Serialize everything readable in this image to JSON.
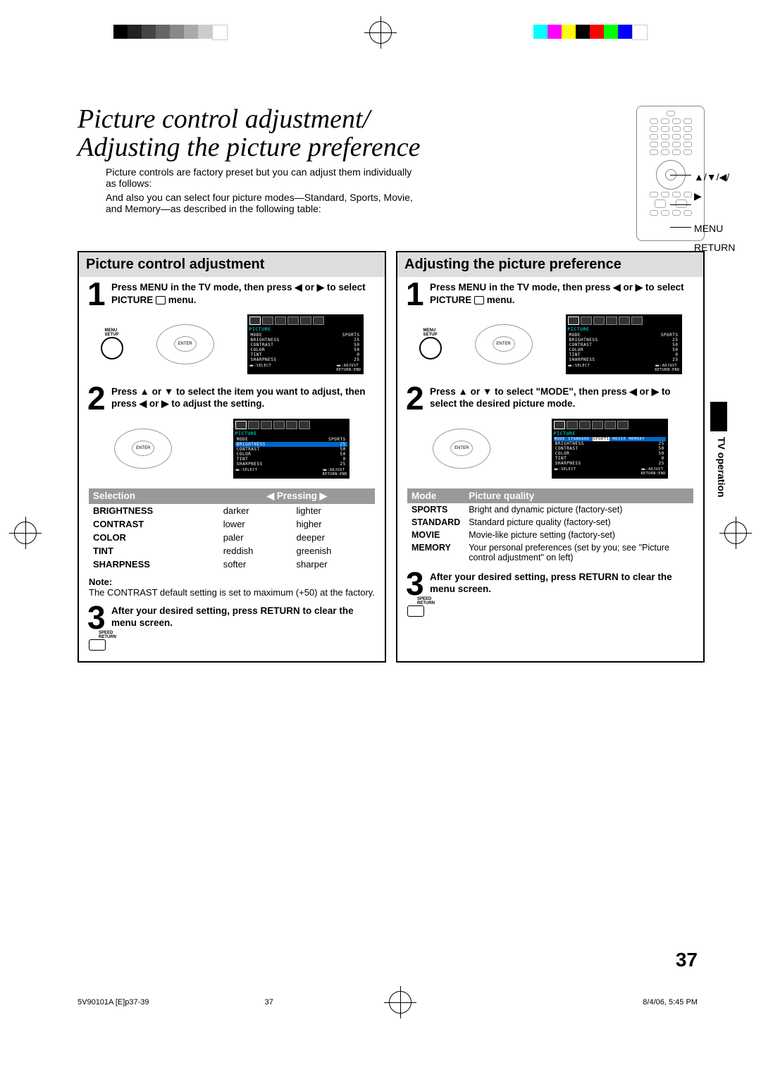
{
  "print_marks": {
    "gray_steps": [
      "#000",
      "#222",
      "#444",
      "#666",
      "#888",
      "#aaa",
      "#ccc",
      "#fff"
    ],
    "color_steps": [
      "#0ff",
      "#f0f",
      "#ff0",
      "#000",
      "#f00",
      "#0f0",
      "#00f",
      "#fff"
    ]
  },
  "title": {
    "line1": "Picture control adjustment/",
    "line2": "Adjusting the picture preference"
  },
  "intro": {
    "p1": "Picture controls are factory preset but you can adjust them individually as follows:",
    "p2": "And also you can select four picture modes—Standard, Sports, Movie, and Memory—as described in the following table:"
  },
  "remote": {
    "arrows_label": "▲/▼/◀/▶",
    "menu_label": "MENU",
    "return_label": "RETURN"
  },
  "side_tab": "TV operation",
  "page_number": "37",
  "footer": {
    "left": "5V90101A [E]p37-39",
    "center": "37",
    "right": "8/4/06, 5:45 PM"
  },
  "left_col": {
    "heading": "Picture control adjustment",
    "step1": "Press MENU in the TV mode, then press ◀ or ▶ to select PICTURE",
    "step1_suffix": " menu.",
    "menu_btn": "MENU\nSETUP",
    "enter_label": "ENTER",
    "step2": "Press ▲ or ▼ to select the item you want to adjust, then press ◀ or ▶ to adjust the setting.",
    "osd": {
      "title": "PICTURE",
      "rows": [
        [
          "MODE",
          "SPORTS"
        ],
        [
          "BRIGHTNESS",
          "25"
        ],
        [
          "CONTRAST",
          "50"
        ],
        [
          "COLOR",
          "50"
        ],
        [
          "TINT",
          "0"
        ],
        [
          "SHARPNESS",
          "25"
        ]
      ],
      "select": "◀▶:SELECT",
      "adjust": "◀▶:ADJUST",
      "end": "RETURN:END"
    },
    "sel_table": {
      "h1": "Selection",
      "h2": "◀  Pressing  ▶",
      "rows": [
        [
          "BRIGHTNESS",
          "darker",
          "lighter"
        ],
        [
          "CONTRAST",
          "lower",
          "higher"
        ],
        [
          "COLOR",
          "paler",
          "deeper"
        ],
        [
          "TINT",
          "reddish",
          "greenish"
        ],
        [
          "SHARPNESS",
          "softer",
          "sharper"
        ]
      ]
    },
    "note_head": "Note:",
    "note_body": "The CONTRAST default setting is set to maximum (+50) at the factory.",
    "step3": "After your desired setting, press RETURN to clear the menu screen.",
    "return_btn": "SPEED\nRETURN"
  },
  "right_col": {
    "heading": "Adjusting the picture preference",
    "step1": "Press MENU in the TV mode, then press ◀ or ▶ to select PICTURE",
    "step1_suffix": " menu.",
    "step2": "Press ▲ or ▼ to select \"MODE\", then press ◀ or ▶ to select the desired picture mode.",
    "osd2": {
      "title": "PICTURE",
      "mode_row": [
        "MODE",
        "STANDARD",
        "SPORTS",
        "MOVIE",
        "MEMORY"
      ],
      "rows": [
        [
          "BRIGHTNESS",
          "25"
        ],
        [
          "CONTRAST",
          "50"
        ],
        [
          "COLOR",
          "50"
        ],
        [
          "TINT",
          "0"
        ],
        [
          "SHARPNESS",
          "25"
        ]
      ]
    },
    "mode_table": {
      "h1": "Mode",
      "h2": "Picture quality",
      "rows": [
        [
          "SPORTS",
          "Bright and dynamic picture (factory-set)"
        ],
        [
          "STANDARD",
          "Standard picture quality (factory-set)"
        ],
        [
          "MOVIE",
          "Movie-like picture setting (factory-set)"
        ],
        [
          "MEMORY",
          "Your personal preferences (set by you; see \"Picture control adjustment\" on left)"
        ]
      ]
    },
    "step3": "After your desired setting, press RETURN to clear the menu screen."
  }
}
